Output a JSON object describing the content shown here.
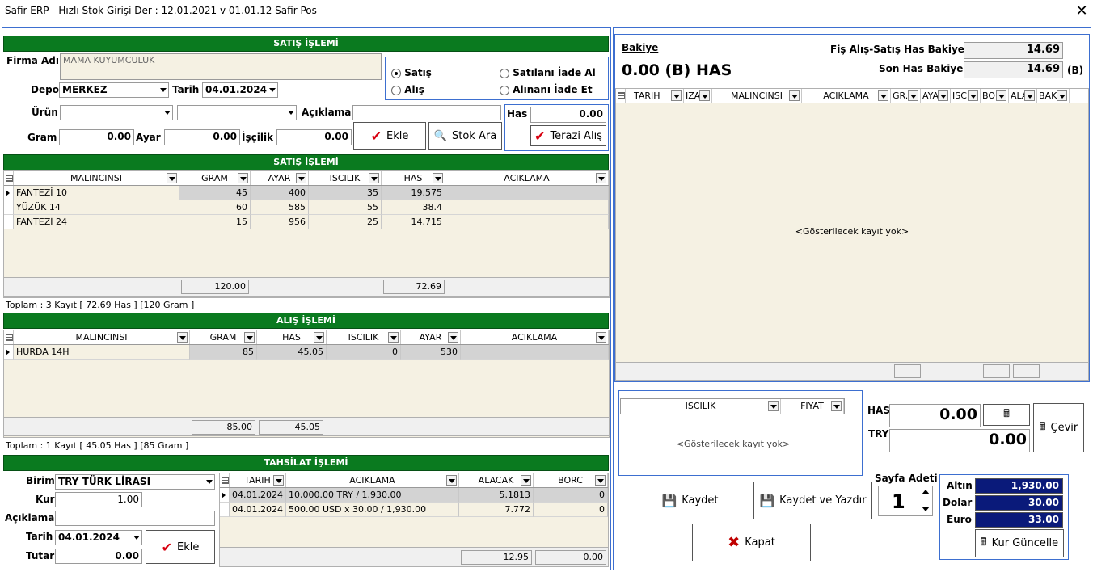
{
  "window": {
    "title": "Safir ERP - Hızlı Stok Girişi  Der : 12.01.2021 v 01.01.12 Safir Pos",
    "close": "✕"
  },
  "sales_header": "SATIŞ İŞLEMİ",
  "form": {
    "firma_label": "Firma Adı",
    "firma_value": "MAMA KUYUMCULUK",
    "depo_label": "Depo",
    "depo_value": "MERKEZ",
    "tarih_label": "Tarih",
    "tarih_value": "04.01.2024",
    "radio_satis": "Satış",
    "radio_alis": "Alış",
    "radio_satilani": "Satılanı İade Al",
    "radio_alinani": "Alınanı İade Et",
    "urun_label": "Ürün",
    "aciklama_label": "Açıklama",
    "gram_label": "Gram",
    "gram_value": "0.00",
    "ayar_label": "Ayar",
    "ayar_value": "0.00",
    "iscilik_label": "İşçilik",
    "iscilik_value": "0.00",
    "ekle": "Ekle",
    "stok_ara": "Stok Ara",
    "has_label": "Has",
    "has_value": "0.00",
    "terazi": "Terazi Alış"
  },
  "sales_grid": {
    "title": "SATIŞ İŞLEMİ",
    "columns": [
      "MALINCINSI",
      "GRAM",
      "AYAR",
      "ISCILIK",
      "HAS",
      "ACIKLAMA"
    ],
    "rows": [
      [
        "FANTEZİ 10",
        "45",
        "400",
        "35",
        "19.575",
        ""
      ],
      [
        "YÜZÜK 14",
        "60",
        "585",
        "55",
        "38.4",
        ""
      ],
      [
        "FANTEZİ 24",
        "15",
        "956",
        "25",
        "14.715",
        ""
      ]
    ],
    "sum_gram": "120.00",
    "sum_has": "72.69",
    "status": "Toplam : 3  Kayıt [ 72.69 Has ]    [120 Gram ]"
  },
  "purchase_grid": {
    "title": "ALIŞ İŞLEMİ",
    "columns": [
      "MALINCINSI",
      "GRAM",
      "HAS",
      "ISCILIK",
      "AYAR",
      "ACIKLAMA"
    ],
    "rows": [
      [
        "HURDA 14H",
        "85",
        "45.05",
        "0",
        "530",
        ""
      ]
    ],
    "sum_gram": "85.00",
    "sum_has": "45.05",
    "status": "Toplam : 1  Kayıt [ 45.05 Has ]    [85 Gram ]"
  },
  "collection": {
    "title": "TAHSİLAT İŞLEMİ",
    "birim_label": "Birim",
    "birim_value": "TRY TÜRK LİRASI",
    "kur_label": "Kur",
    "kur_value": "1.00",
    "aciklama_label": "Açıklama",
    "tarih_label": "Tarih",
    "tarih_value": "04.01.2024",
    "tutar_label": "Tutar",
    "tutar_value": "0.00",
    "ekle": "Ekle",
    "columns": [
      "TARIH",
      "ACIKLAMA",
      "ALACAK",
      "BORC"
    ],
    "rows": [
      [
        "04.01.2024",
        "10,000.00 TRY / 1,930.00",
        "5.1813",
        "0"
      ],
      [
        "04.01.2024",
        "500.00 USD x 30.00 / 1,930.00",
        "7.772",
        "0"
      ]
    ],
    "sum_alacak": "12.95",
    "sum_borc": "0.00"
  },
  "balance": {
    "bakiye_label": "Bakiye",
    "bakiye_value": "0.00 (B) HAS",
    "fis_label": "Fiş Alış-Satış Has Bakiye",
    "fis_value": "14.69",
    "son_label": "Son Has Bakiye",
    "son_value": "14.69",
    "son_suffix": "(B)"
  },
  "history_grid": {
    "columns": [
      "TARIH",
      "IZA",
      "MALINCINSI",
      "ACIKLAMA",
      "GR.",
      "AYA",
      "ISC",
      "BO",
      "ALA",
      "BAK"
    ],
    "empty": "<Gösterilecek kayıt yok>"
  },
  "iscilik_grid": {
    "columns": [
      "ISCILIK",
      "FIYAT"
    ],
    "empty": "<Gösterilecek kayıt yok>"
  },
  "converter": {
    "has_label": "HAS",
    "has_value": "0.00",
    "try_label": "TRY",
    "try_value": "0.00",
    "cevir": "Çevir"
  },
  "page": {
    "sayfa_label": "Sayfa Adeti",
    "sayfa_value": "1"
  },
  "actions": {
    "kaydet": "Kaydet",
    "kaydet_yazdir": "Kaydet ve Yazdır",
    "kapat": "Kapat"
  },
  "rates": {
    "altin_label": "Altın",
    "altin_value": "1,930.00",
    "dolar_label": "Dolar",
    "dolar_value": "30.00",
    "euro_label": "Euro",
    "euro_value": "33.00",
    "kur_guncelle": "Kur Güncelle"
  }
}
